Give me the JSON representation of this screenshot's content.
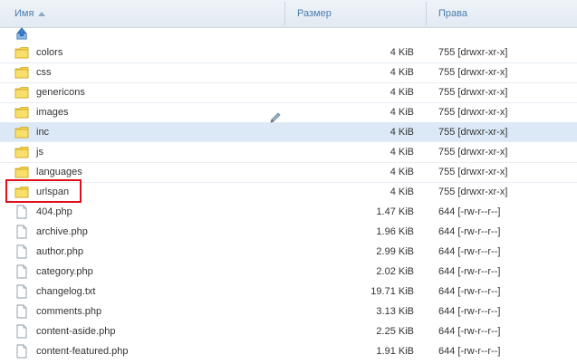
{
  "columns": {
    "name": "Имя",
    "size": "Размер",
    "permissions": "Права"
  },
  "colors": {
    "header_text": "#4b7cae",
    "selected_row": "#dbe9f6",
    "highlight_border": "#e0101a",
    "folder": "#f5d44a"
  },
  "up_icon": "up-folder-icon",
  "edit_icon": "pencil-icon",
  "files": [
    {
      "name": "colors",
      "size": "4 KiB",
      "perms": "755 [drwxr-xr-x]",
      "type": "folder"
    },
    {
      "name": "css",
      "size": "4 KiB",
      "perms": "755 [drwxr-xr-x]",
      "type": "folder"
    },
    {
      "name": "genericons",
      "size": "4 KiB",
      "perms": "755 [drwxr-xr-x]",
      "type": "folder"
    },
    {
      "name": "images",
      "size": "4 KiB",
      "perms": "755 [drwxr-xr-x]",
      "type": "folder"
    },
    {
      "name": "inc",
      "size": "4 KiB",
      "perms": "755 [drwxr-xr-x]",
      "type": "folder"
    },
    {
      "name": "js",
      "size": "4 KiB",
      "perms": "755 [drwxr-xr-x]",
      "type": "folder"
    },
    {
      "name": "languages",
      "size": "4 KiB",
      "perms": "755 [drwxr-xr-x]",
      "type": "folder"
    },
    {
      "name": "urlspan",
      "size": "4 KiB",
      "perms": "755 [drwxr-xr-x]",
      "type": "folder"
    },
    {
      "name": "404.php",
      "size": "1.47 KiB",
      "perms": "644 [-rw-r--r--]",
      "type": "file"
    },
    {
      "name": "archive.php",
      "size": "1.96 KiB",
      "perms": "644 [-rw-r--r--]",
      "type": "file"
    },
    {
      "name": "author.php",
      "size": "2.99 KiB",
      "perms": "644 [-rw-r--r--]",
      "type": "file"
    },
    {
      "name": "category.php",
      "size": "2.02 KiB",
      "perms": "644 [-rw-r--r--]",
      "type": "file"
    },
    {
      "name": "changelog.txt",
      "size": "19.71 KiB",
      "perms": "644 [-rw-r--r--]",
      "type": "file"
    },
    {
      "name": "comments.php",
      "size": "3.13 KiB",
      "perms": "644 [-rw-r--r--]",
      "type": "file"
    },
    {
      "name": "content-aside.php",
      "size": "2.25 KiB",
      "perms": "644 [-rw-r--r--]",
      "type": "file"
    },
    {
      "name": "content-featured.php",
      "size": "1.91 KiB",
      "perms": "644 [-rw-r--r--]",
      "type": "file"
    }
  ]
}
